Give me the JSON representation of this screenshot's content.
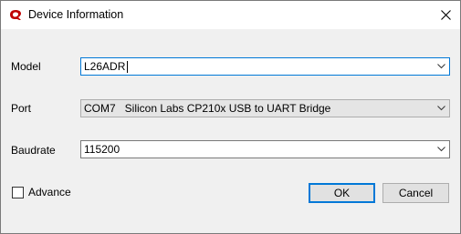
{
  "window": {
    "title": "Device Information"
  },
  "fields": {
    "model": {
      "label": "Model",
      "value": "L26ADR"
    },
    "port": {
      "label": "Port",
      "value": "COM7   Silicon Labs CP210x USB to UART Bridge"
    },
    "baudrate": {
      "label": "Baudrate",
      "value": "115200"
    }
  },
  "advance": {
    "label": "Advance",
    "checked": false
  },
  "buttons": {
    "ok": "OK",
    "cancel": "Cancel"
  },
  "colors": {
    "accent": "#0078d7",
    "logo": "#c00000"
  },
  "icons": {
    "app": "quectel-logo-icon",
    "close": "close-icon",
    "dropdown": "chevron-down-icon"
  }
}
